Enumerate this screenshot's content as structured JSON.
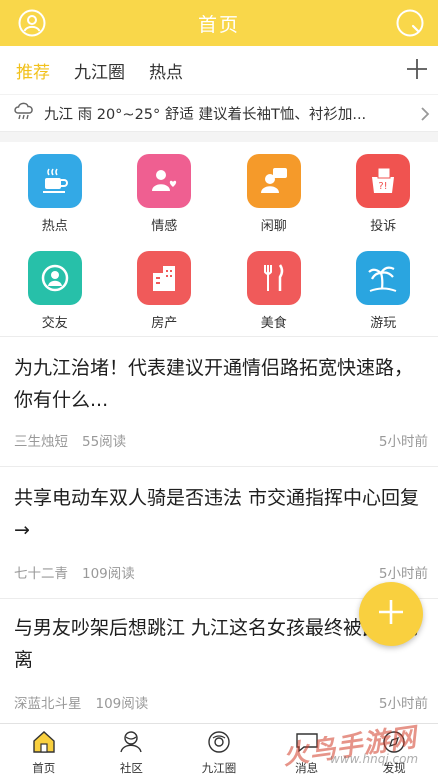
{
  "header": {
    "title": "首页",
    "left_icon": "user-avatar-icon",
    "right_icon": "search-icon"
  },
  "tabs": [
    {
      "label": "推荐",
      "active": true
    },
    {
      "label": "九江圈",
      "active": false
    },
    {
      "label": "热点",
      "active": false
    }
  ],
  "weather": {
    "icon": "cloud-rain-icon",
    "text": "九江 雨 20°~25° 舒适 建议着长袖T恤、衬衫加..."
  },
  "categories": [
    {
      "label": "热点",
      "icon": "coffee-icon",
      "color": "#33a9e6"
    },
    {
      "label": "情感",
      "icon": "person-heart-icon",
      "color": "#ef5f91"
    },
    {
      "label": "闲聊",
      "icon": "chat-person-icon",
      "color": "#f59a2a"
    },
    {
      "label": "投诉",
      "icon": "complaint-box-icon",
      "color": "#f05350"
    },
    {
      "label": "交友",
      "icon": "friend-search-icon",
      "color": "#27c0a9"
    },
    {
      "label": "房产",
      "icon": "building-icon",
      "color": "#f05a5a"
    },
    {
      "label": "美食",
      "icon": "fork-knife-icon",
      "color": "#f05a5a"
    },
    {
      "label": "游玩",
      "icon": "palm-tree-icon",
      "color": "#2aa5e0"
    }
  ],
  "articles": [
    {
      "title": "为九江治堵！代表建议开通情侣路拓宽快速路，你有什么...",
      "author": "三生烛短",
      "reads": "55阅读",
      "time": "5小时前"
    },
    {
      "title": "共享电动车双人骑是否违法 市交通指挥中心回复 →",
      "author": "七十二青",
      "reads": "109阅读",
      "time": "5小时前"
    },
    {
      "title": "与男友吵架后想跳江 九江这名女孩最终被民警劝离",
      "author": "深蓝北斗星",
      "reads": "109阅读",
      "time": "5小时前"
    }
  ],
  "fab": {
    "icon": "plus-icon"
  },
  "bottom_nav": [
    {
      "label": "首页",
      "icon": "home-icon",
      "active": true
    },
    {
      "label": "社区",
      "icon": "community-icon",
      "active": false
    },
    {
      "label": "九江圈",
      "icon": "circle-icon",
      "active": false
    },
    {
      "label": "消息",
      "icon": "message-icon",
      "active": false
    },
    {
      "label": "发现",
      "icon": "discover-icon",
      "active": false
    }
  ],
  "watermark": {
    "text": "火鸟手游网",
    "url": "www.hnqj.com"
  }
}
